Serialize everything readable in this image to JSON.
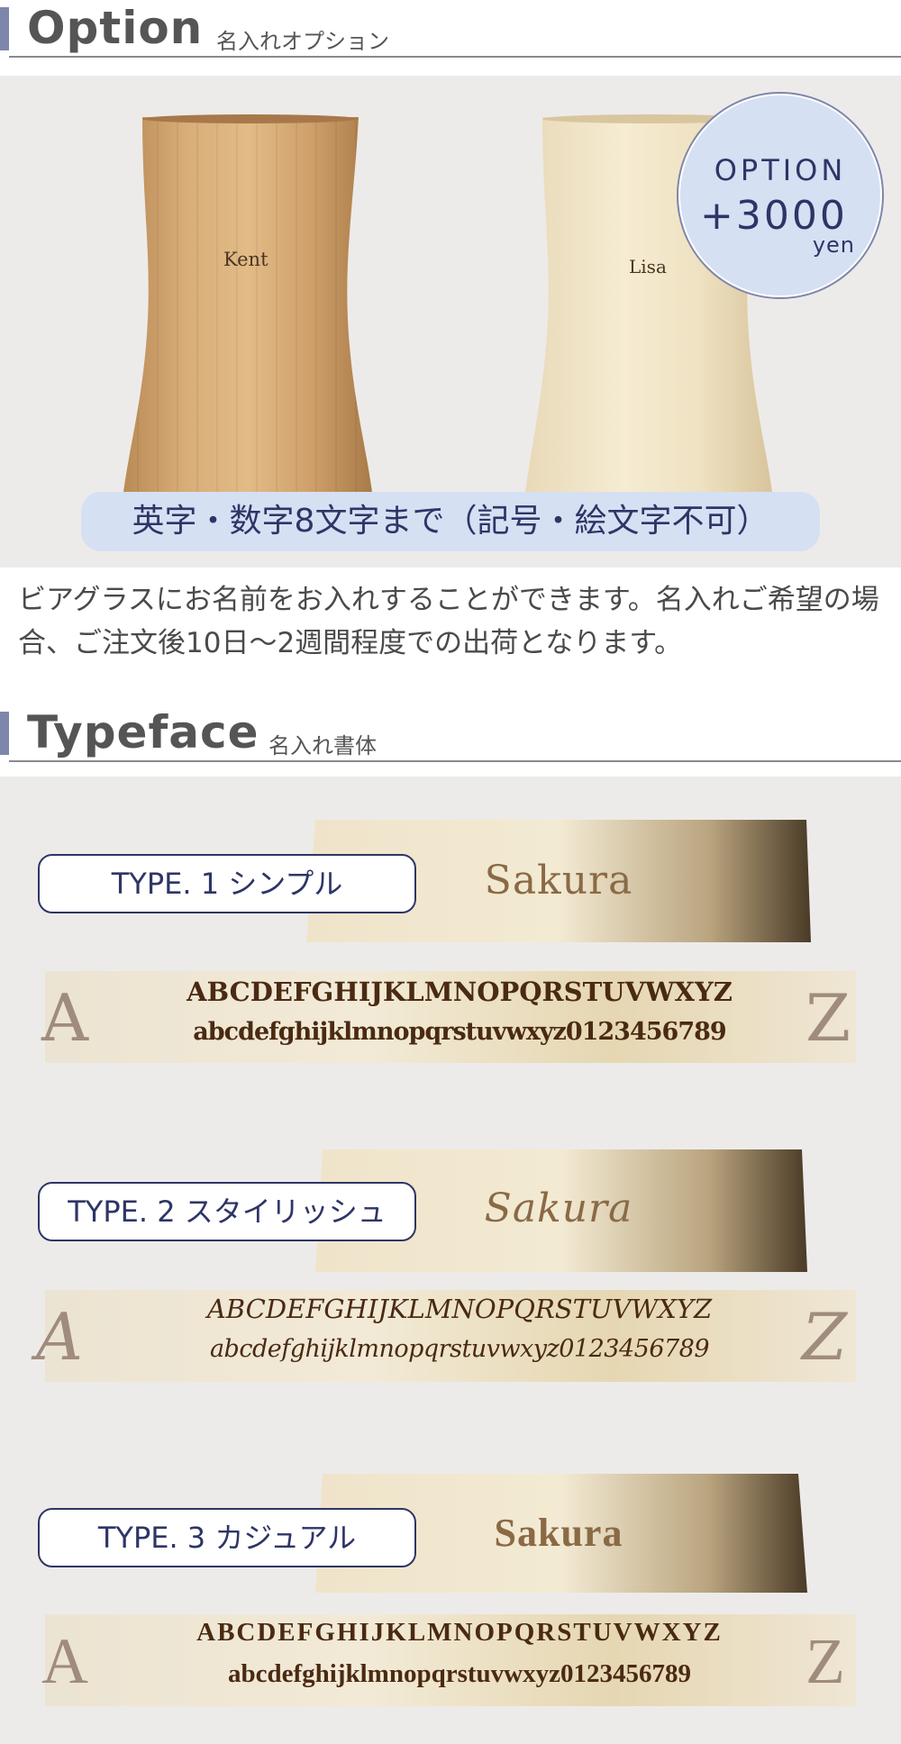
{
  "option": {
    "title": "Option",
    "subtitle": "名入れオプション",
    "price_badge": {
      "label": "OPTION",
      "amount": "+3000",
      "unit": "yen"
    },
    "cups": [
      {
        "name": "Kent",
        "wood": "bamboo"
      },
      {
        "name": "Lisa",
        "wood": "light wood"
      }
    ],
    "limit_note": "英字・数字8文字まで（記号・絵文字不可）",
    "description": "ビアグラスにお名前をお入れすることができます。名入れご希望の場合、ご注文後10日～2週間程度での出荷となります。"
  },
  "typeface": {
    "title": "Typeface",
    "subtitle": "名入れ書体",
    "types": [
      {
        "label": "TYPE. 1 シンプル",
        "sample": "Sakura",
        "big_upper": "A",
        "big_lower": "Z",
        "uppercase": "ABCDEFGHIJKLMNOPQRSTUVWXYZ",
        "lowercase": "abcdefghijklmnopqrstuvwxyz0123456789"
      },
      {
        "label": "TYPE. 2 スタイリッシュ",
        "sample": "Sakura",
        "big_upper": "A",
        "big_lower": "Z",
        "uppercase": "ABCDEFGHIJKLMNOPQRSTUVWXYZ",
        "lowercase": "abcdefghijklmnopqrstuvwxyz0123456789"
      },
      {
        "label": "TYPE. 3 カジュアル",
        "sample": "Sakura",
        "big_upper": "A",
        "big_lower": "Z",
        "uppercase": "ABCDEFGHIJKLMNOPQRSTUVWXYZ",
        "lowercase": "abcdefghijklmnopqrstuvwxyz0123456789"
      }
    ]
  },
  "colors": {
    "accent_bar": "#7f86ab",
    "badge_bg": "#d5e0f3",
    "navy_text": "#2e3566",
    "panel_bg": "#edebe9",
    "engrave_brown": "#8a6a45"
  }
}
